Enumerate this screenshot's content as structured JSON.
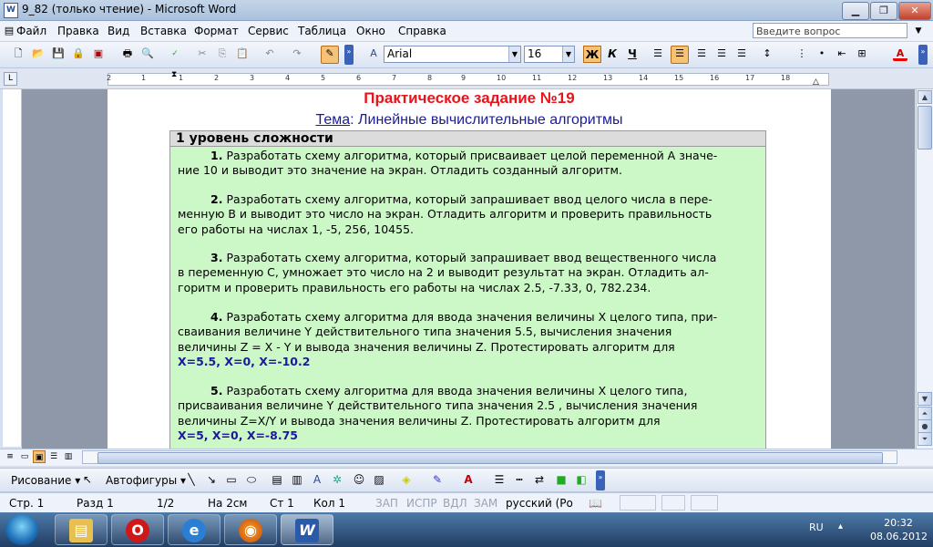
{
  "window": {
    "title": "9_82 (только чтение) - Microsoft Word"
  },
  "menu": {
    "items": [
      "Файл",
      "Правка",
      "Вид",
      "Вставка",
      "Формат",
      "Сервис",
      "Таблица",
      "Окно",
      "Справка"
    ],
    "ask_placeholder": "Введите вопрос"
  },
  "toolbar": {
    "font_name": "Arial",
    "font_size": "16",
    "bold": "Ж",
    "italic": "К",
    "underline": "Ч"
  },
  "ruler": {
    "ticks": [
      "2",
      "1",
      "1",
      "2",
      "3",
      "4",
      "5",
      "6",
      "7",
      "8",
      "9",
      "10",
      "11",
      "12",
      "13",
      "14",
      "15",
      "16",
      "17",
      "18"
    ]
  },
  "document": {
    "title": "Практическое задание №19",
    "subtitle_label": "Тема",
    "subtitle_text": ": Линейные вычислительные алгоритмы",
    "level_heading": "1 уровень сложности",
    "tasks": [
      {
        "num": "1.",
        "lines": [
          "Разработать схему алгоритма, который присваивает целой переменной А значе-",
          "ние 10 и выводит это значение на экран. Отладить созданный алгоритм."
        ]
      },
      {
        "num": "2.",
        "lines": [
          "Разработать схему алгоритма, который запрашивает ввод целого числа в пере-",
          "менную В и выводит это число на экран. Отладить алгоритм и проверить правильность",
          "его работы на числах 1, -5, 256, 10455."
        ]
      },
      {
        "num": "3.",
        "lines": [
          "Разработать схему алгоритма, который запрашивает ввод вещественного числа",
          "в переменную С, умножает это число на 2 и выводит результат на экран. Отладить ал-",
          "горитм и проверить правильность его работы  на числах 2.5, -7.33, 0,  782.234."
        ]
      },
      {
        "num": "4.",
        "lines": [
          "Разработать схему алгоритма для ввода значения величины Х  целого типа, при-",
          "сваивания  величине Y действительного  типа значения 5.5, вычисления значения",
          "величины   Z = X - Y   и вывода значения величины Z. Протестировать алгоритм для",
          "X=5.5, X=0, X=-10.2"
        ]
      },
      {
        "num": "5.",
        "lines": [
          "Разработать схему алгоритма для ввода значения величины Х   целого   типа,",
          "присваивания  величине Y действительного  типа значения 2.5 , вычисления значения",
          "величины    Z=X/Y    и вывода значения величины Z. Протестировать алгоритм для",
          "X=5, X=0, X=-8.75"
        ]
      }
    ]
  },
  "drawing_toolbar": {
    "draw_label": "Рисование",
    "autoshapes_label": "Автофигуры"
  },
  "status": {
    "page": "Стр.  1",
    "section": "Разд  1",
    "pages": "1/2",
    "at": "На  2см",
    "line": "Ст  1",
    "col": "Кол  1",
    "rec": "ЗАП",
    "trk": "ИСПР",
    "ext": "ВДЛ",
    "ovr": "ЗАМ",
    "language": "русский (Ро"
  },
  "taskbar": {
    "lang": "RU",
    "time": "20:32",
    "date": "08.06.2012"
  }
}
